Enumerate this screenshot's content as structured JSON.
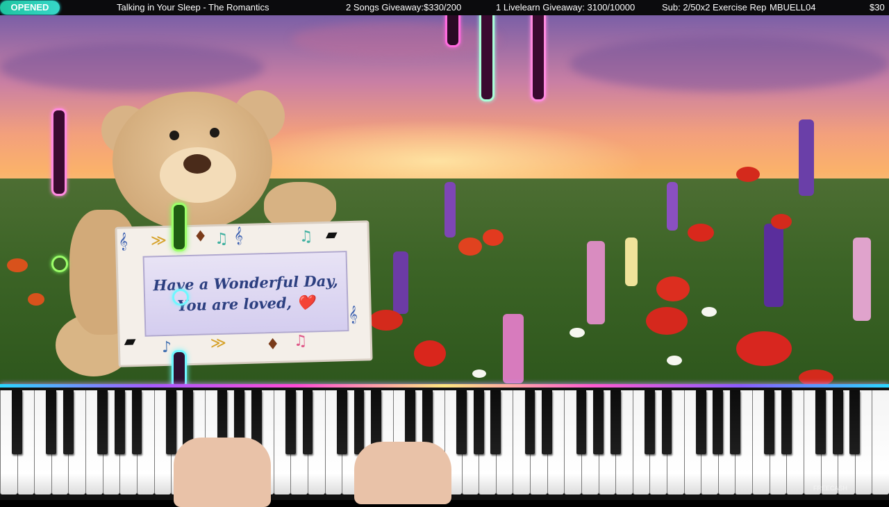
{
  "topbar": {
    "status": "OPENED",
    "song": "Talking in Your Sleep - The Romantics",
    "giveaway_songs": "2 Songs Giveaway:$330/200",
    "giveaway_livelearn": "1 Livelearn Giveaway: 3100/10000",
    "sub_goal": "Sub: 2/50x2 Exercise Rep",
    "user": "MBUELL04",
    "amount": "$30"
  },
  "sign": {
    "line1": "Have a Wonderful Day,",
    "line2": "You are loved, ❤️"
  },
  "colors": {
    "status_pill": "#1ec4a0",
    "neon_green": "#7dff5a",
    "neon_pink": "#ff6adf",
    "neon_cyan": "#6ff7ff"
  },
  "watermark": "FREECASH"
}
